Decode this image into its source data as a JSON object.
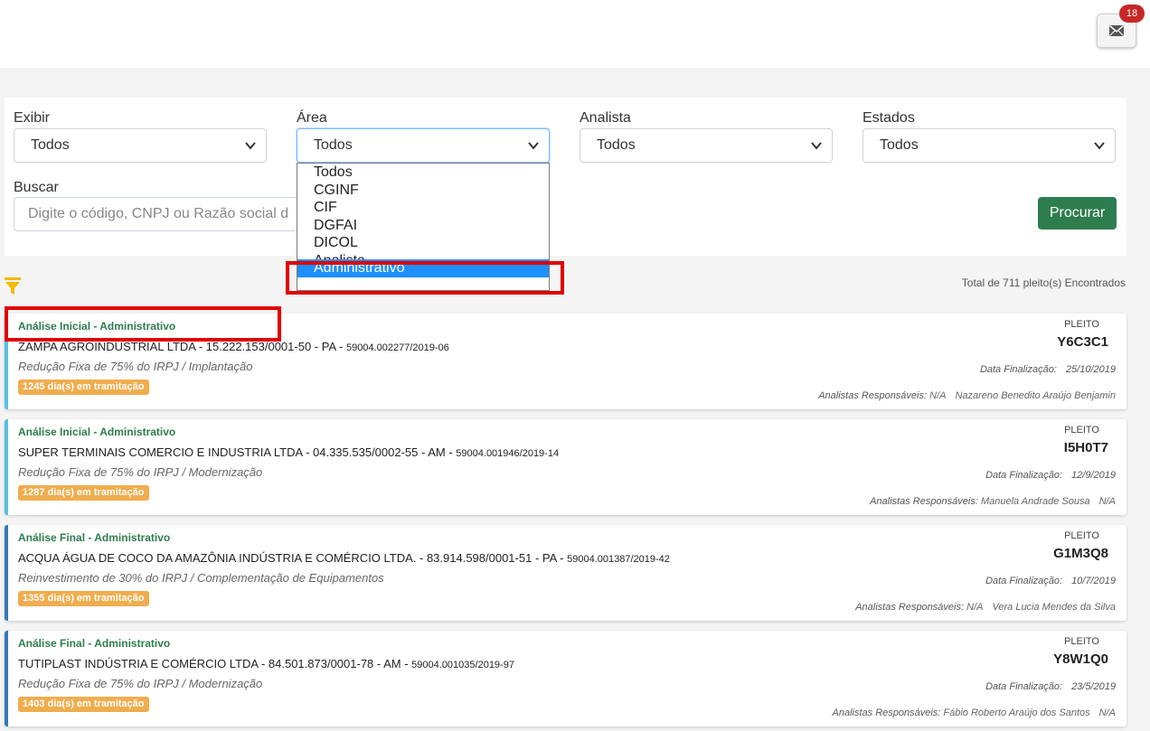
{
  "header": {
    "mail_count": "18",
    "mail_icon": "envelope-icon"
  },
  "filters": {
    "exibir": {
      "label": "Exibir",
      "value": "Todos"
    },
    "area": {
      "label": "Área",
      "value": "Todos"
    },
    "analista": {
      "label": "Analista",
      "value": "Todos"
    },
    "estados": {
      "label": "Estados",
      "value": "Todos"
    },
    "buscar": {
      "label": "Buscar",
      "placeholder": "Digite o código, CNPJ ou Razão social do pleito"
    },
    "search_button": "Procurar"
  },
  "area_dropdown": {
    "options": [
      "Todos",
      "CGINF",
      "CIF",
      "DGFAI",
      "DICOL",
      "Analista",
      "Administrativo"
    ],
    "highlighted": "Administrativo"
  },
  "results": {
    "total_text": "Total de 711 pleito(s) Encontrados"
  },
  "accent_colors": {
    "status_green": "#2e7d4f",
    "badge_orange": "#f0ad4e",
    "highlight_red": "#e00000",
    "selected_blue": "#1e90ff"
  },
  "cards": [
    {
      "status": "Análise Inicial - Administrativo",
      "company": "ZAMPA AGROINDUSTRIAL LTDA - 15.222.153/0001-50 - PA - ",
      "process": "59004.002277/2019-06",
      "benefit": "Redução Fixa de 75% do IRPJ / Implantação",
      "days": "1245 dia(s) em tramitação",
      "pleito_label": "PLEITO",
      "pleito_code": "Y6C3C1",
      "date_label": "Data Finalização:",
      "date": "25/10/2019",
      "analysts_label": "Analistas Responsáveis:",
      "analysts": "N/A",
      "analysts_2": "Nazareno Benedito Araújo Benjamin"
    },
    {
      "status": "Análise Inicial - Administrativo",
      "company": "SUPER TERMINAIS COMERCIO E INDUSTRIA LTDA - 04.335.535/0002-55 - AM - ",
      "process": "59004.001946/2019-14",
      "benefit": "Redução Fixa de 75% do IRPJ / Modernização",
      "days": "1287 dia(s) em tramitação",
      "pleito_label": "PLEITO",
      "pleito_code": "I5H0T7",
      "date_label": "Data Finalização:",
      "date": "12/9/2019",
      "analysts_label": "Analistas Responsáveis:",
      "analysts": "Manuela Andrade Sousa",
      "analysts_2": "N/A"
    },
    {
      "status": "Análise Final - Administrativo",
      "company": "ACQUA ÁGUA DE COCO DA AMAZÔNIA INDÚSTRIA E COMÉRCIO LTDA. - 83.914.598/0001-51 - PA - ",
      "process": "59004.001387/2019-42",
      "benefit": "Reinvestimento de 30% do IRPJ / Complementação de Equipamentos",
      "days": "1355 dia(s) em tramitação",
      "pleito_label": "PLEITO",
      "pleito_code": "G1M3Q8",
      "date_label": "Data Finalização:",
      "date": "10/7/2019",
      "analysts_label": "Analistas Responsáveis:",
      "analysts": "N/A",
      "analysts_2": "Vera Lucia Mendes da Silva"
    },
    {
      "status": "Análise Final - Administrativo",
      "company": "TUTIPLAST INDÚSTRIA E COMÉRCIO LTDA - 84.501.873/0001-78 - AM - ",
      "process": "59004.001035/2019-97",
      "benefit": "Redução Fixa de 75% do IRPJ / Modernização",
      "days": "1403 dia(s) em tramitação",
      "pleito_label": "PLEITO",
      "pleito_code": "Y8W1Q0",
      "date_label": "Data Finalização:",
      "date": "23/5/2019",
      "analysts_label": "Analistas Responsáveis:",
      "analysts": "Fábio Roberto Araújo dos Santos",
      "analysts_2": "N/A"
    }
  ]
}
